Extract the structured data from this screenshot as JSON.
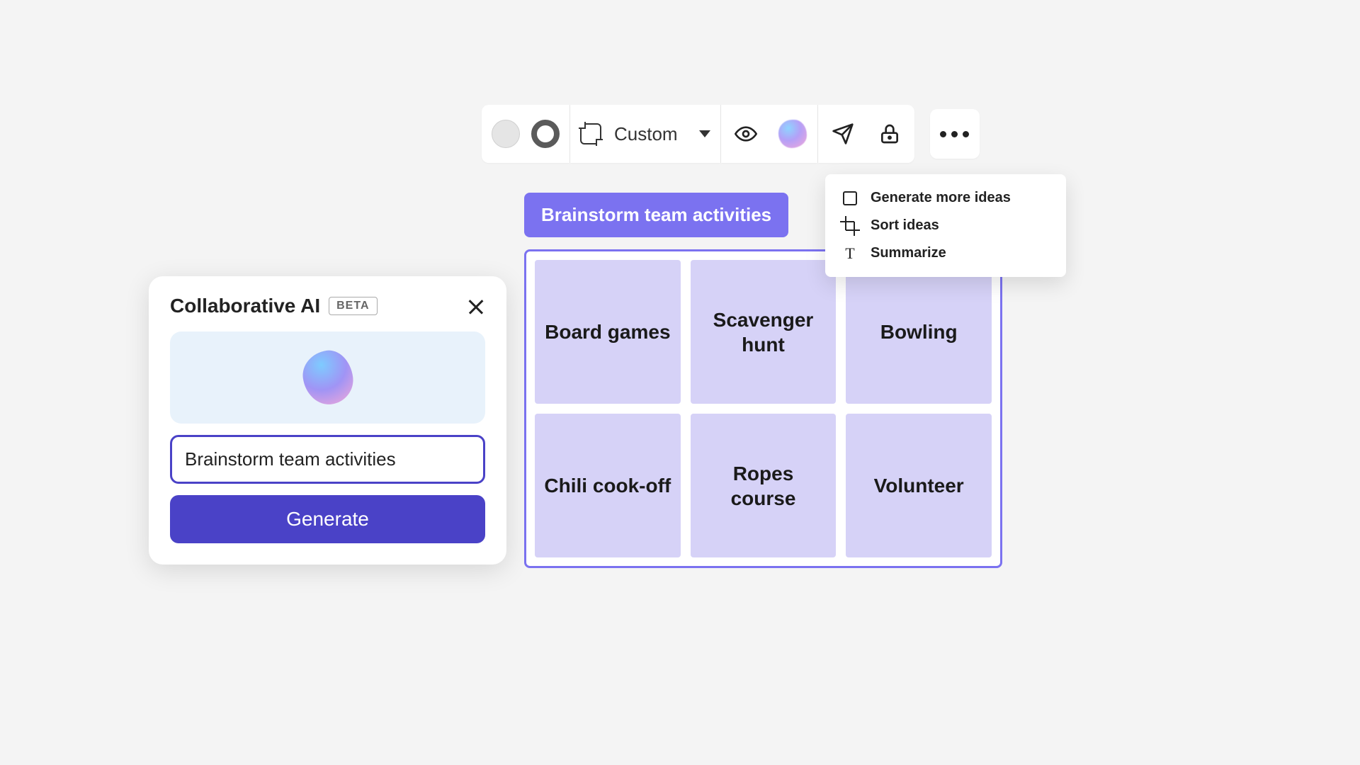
{
  "toolbar": {
    "frame_size_label": "Custom"
  },
  "dropdown": {
    "items": [
      {
        "label": "Generate more ideas"
      },
      {
        "label": "Sort ideas"
      },
      {
        "label": "Summarize"
      }
    ]
  },
  "frame": {
    "title": "Brainstorm team activities",
    "cards": [
      "Board games",
      "Scavenger hunt",
      "Bowling",
      "Chili cook-off",
      "Ropes course",
      "Volunteer"
    ]
  },
  "ai_panel": {
    "title": "Collaborative AI",
    "badge": "BETA",
    "input_value": "Brainstorm team activities",
    "button_label": "Generate"
  }
}
